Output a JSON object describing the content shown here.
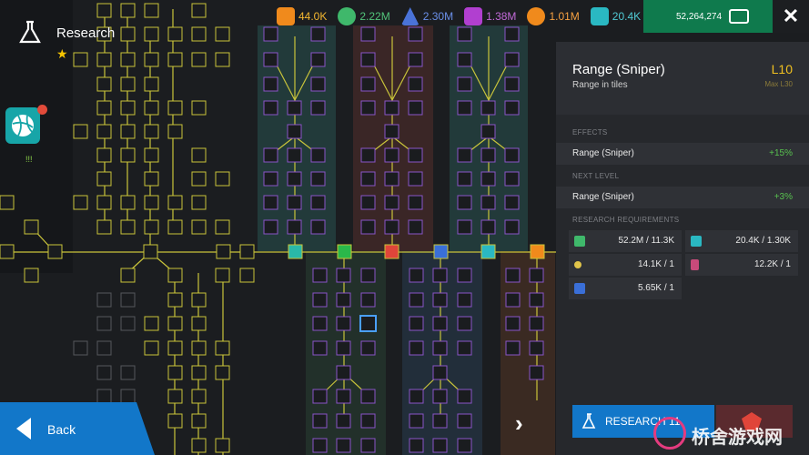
{
  "header": {
    "title": "Research"
  },
  "resources": [
    {
      "icon": "coin-hex-icon",
      "value": "44.0K",
      "color": "#f08a1c"
    },
    {
      "icon": "green-orb-icon",
      "value": "2.22M",
      "color": "#3fb86b"
    },
    {
      "icon": "blue-triangle-icon",
      "value": "2.30M",
      "color": "#4a73d8"
    },
    {
      "icon": "purple-stripe-icon",
      "value": "1.38M",
      "color": "#b13fd0"
    },
    {
      "icon": "orange-ball-icon",
      "value": "1.01M",
      "color": "#f08a1c"
    },
    {
      "icon": "teal-stripe-icon",
      "value": "20.4K",
      "color": "#2ab8c2"
    }
  ],
  "money": {
    "value": "52,264,274"
  },
  "left_item": {
    "count": "!!!"
  },
  "navigation": {
    "back_label": "Back"
  },
  "panel": {
    "title": "Range (Sniper)",
    "subtitle": "Range in tiles",
    "level": "L10",
    "max_level": "Max L30",
    "effects_heading": "EFFECTS",
    "effect": {
      "label": "Range (Sniper)",
      "value": "+15%"
    },
    "next_level_heading": "NEXT LEVEL",
    "next_level": {
      "label": "Range (Sniper)",
      "value": "+3%"
    },
    "requirements_heading": "RESEARCH REQUIREMENTS",
    "requirements": [
      {
        "icon": "green-cash-icon",
        "value": "52.2M / 11.3K",
        "color": "#3fb86b"
      },
      {
        "icon": "teal-stripe-icon",
        "value": "20.4K / 1.30K",
        "color": "#2ab8c2"
      },
      {
        "icon": "yellow-key-icon",
        "value": "14.1K / 1",
        "color": "#e0c44a"
      },
      {
        "icon": "pink-card-icon",
        "value": "12.2K / 1",
        "color": "#c84a7a"
      },
      {
        "icon": "blue-star-icon",
        "value": "5.65K / 1",
        "color": "#3a6fd8"
      }
    ],
    "research_label": "RESEARCH 11"
  },
  "watermark": {
    "text": "桥舍游戏网"
  }
}
